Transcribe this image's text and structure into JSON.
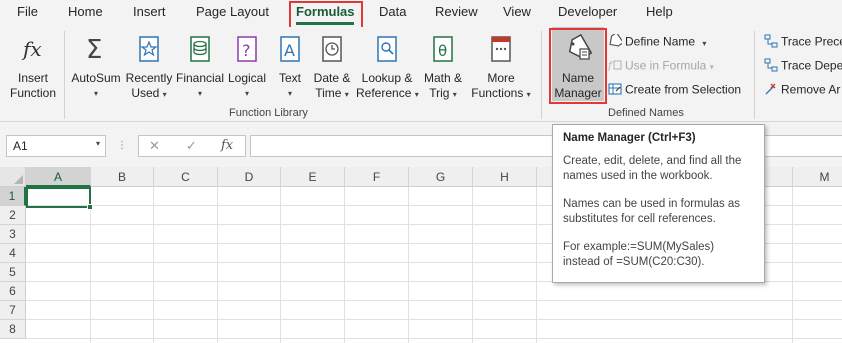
{
  "menu": {
    "file": "File",
    "home": "Home",
    "insert": "Insert",
    "page_layout": "Page Layout",
    "formulas": "Formulas",
    "data": "Data",
    "review": "Review",
    "view": "View",
    "developer": "Developer",
    "help": "Help"
  },
  "ribbon": {
    "insert_function": {
      "line1": "Insert",
      "line2": "Function"
    },
    "autosum": {
      "line1": "AutoSum",
      "caret": "⌄"
    },
    "recently_used": {
      "line1": "Recently",
      "line2": "Used"
    },
    "financial": {
      "line1": "Financial"
    },
    "logical": {
      "line1": "Logical"
    },
    "text": {
      "line1": "Text"
    },
    "date_time": {
      "line1": "Date &",
      "line2": "Time"
    },
    "lookup": {
      "line1": "Lookup &",
      "line2": "Reference"
    },
    "math": {
      "line1": "Math &",
      "line2": "Trig"
    },
    "more": {
      "line1": "More",
      "line2": "Functions"
    },
    "function_library_label": "Function Library",
    "name_manager": {
      "line1": "Name",
      "line2": "Manager"
    },
    "define_name": "Define Name",
    "use_in_formula": "Use in Formula",
    "create_from_selection": "Create from Selection",
    "defined_names_label": "Defined Names",
    "trace_precedents": "Trace Prece",
    "trace_dependents": "Trace Depe",
    "remove_arrows": "Remove Ar"
  },
  "formula_bar": {
    "name_box": "A1",
    "cancel": "✕",
    "enter": "✓",
    "fx": "fx"
  },
  "grid": {
    "columns": [
      "A",
      "B",
      "C",
      "D",
      "E",
      "F",
      "G",
      "H",
      "M"
    ],
    "rows": [
      "1",
      "2",
      "3",
      "4",
      "5",
      "6",
      "7",
      "8"
    ]
  },
  "tooltip": {
    "title": "Name Manager (Ctrl+F3)",
    "para1": "Create, edit, delete, and find all the names used in the workbook.",
    "para2": "Names can be used in formulas as substitutes for cell references.",
    "para3_line1": "For example:=SUM(MySales)",
    "para3_line2": "instead of =SUM(C20:C30)."
  },
  "colors": {
    "accent_green": "#217346",
    "highlight_red": "#e03838",
    "ribbon_bg": "#f3f3f3"
  }
}
